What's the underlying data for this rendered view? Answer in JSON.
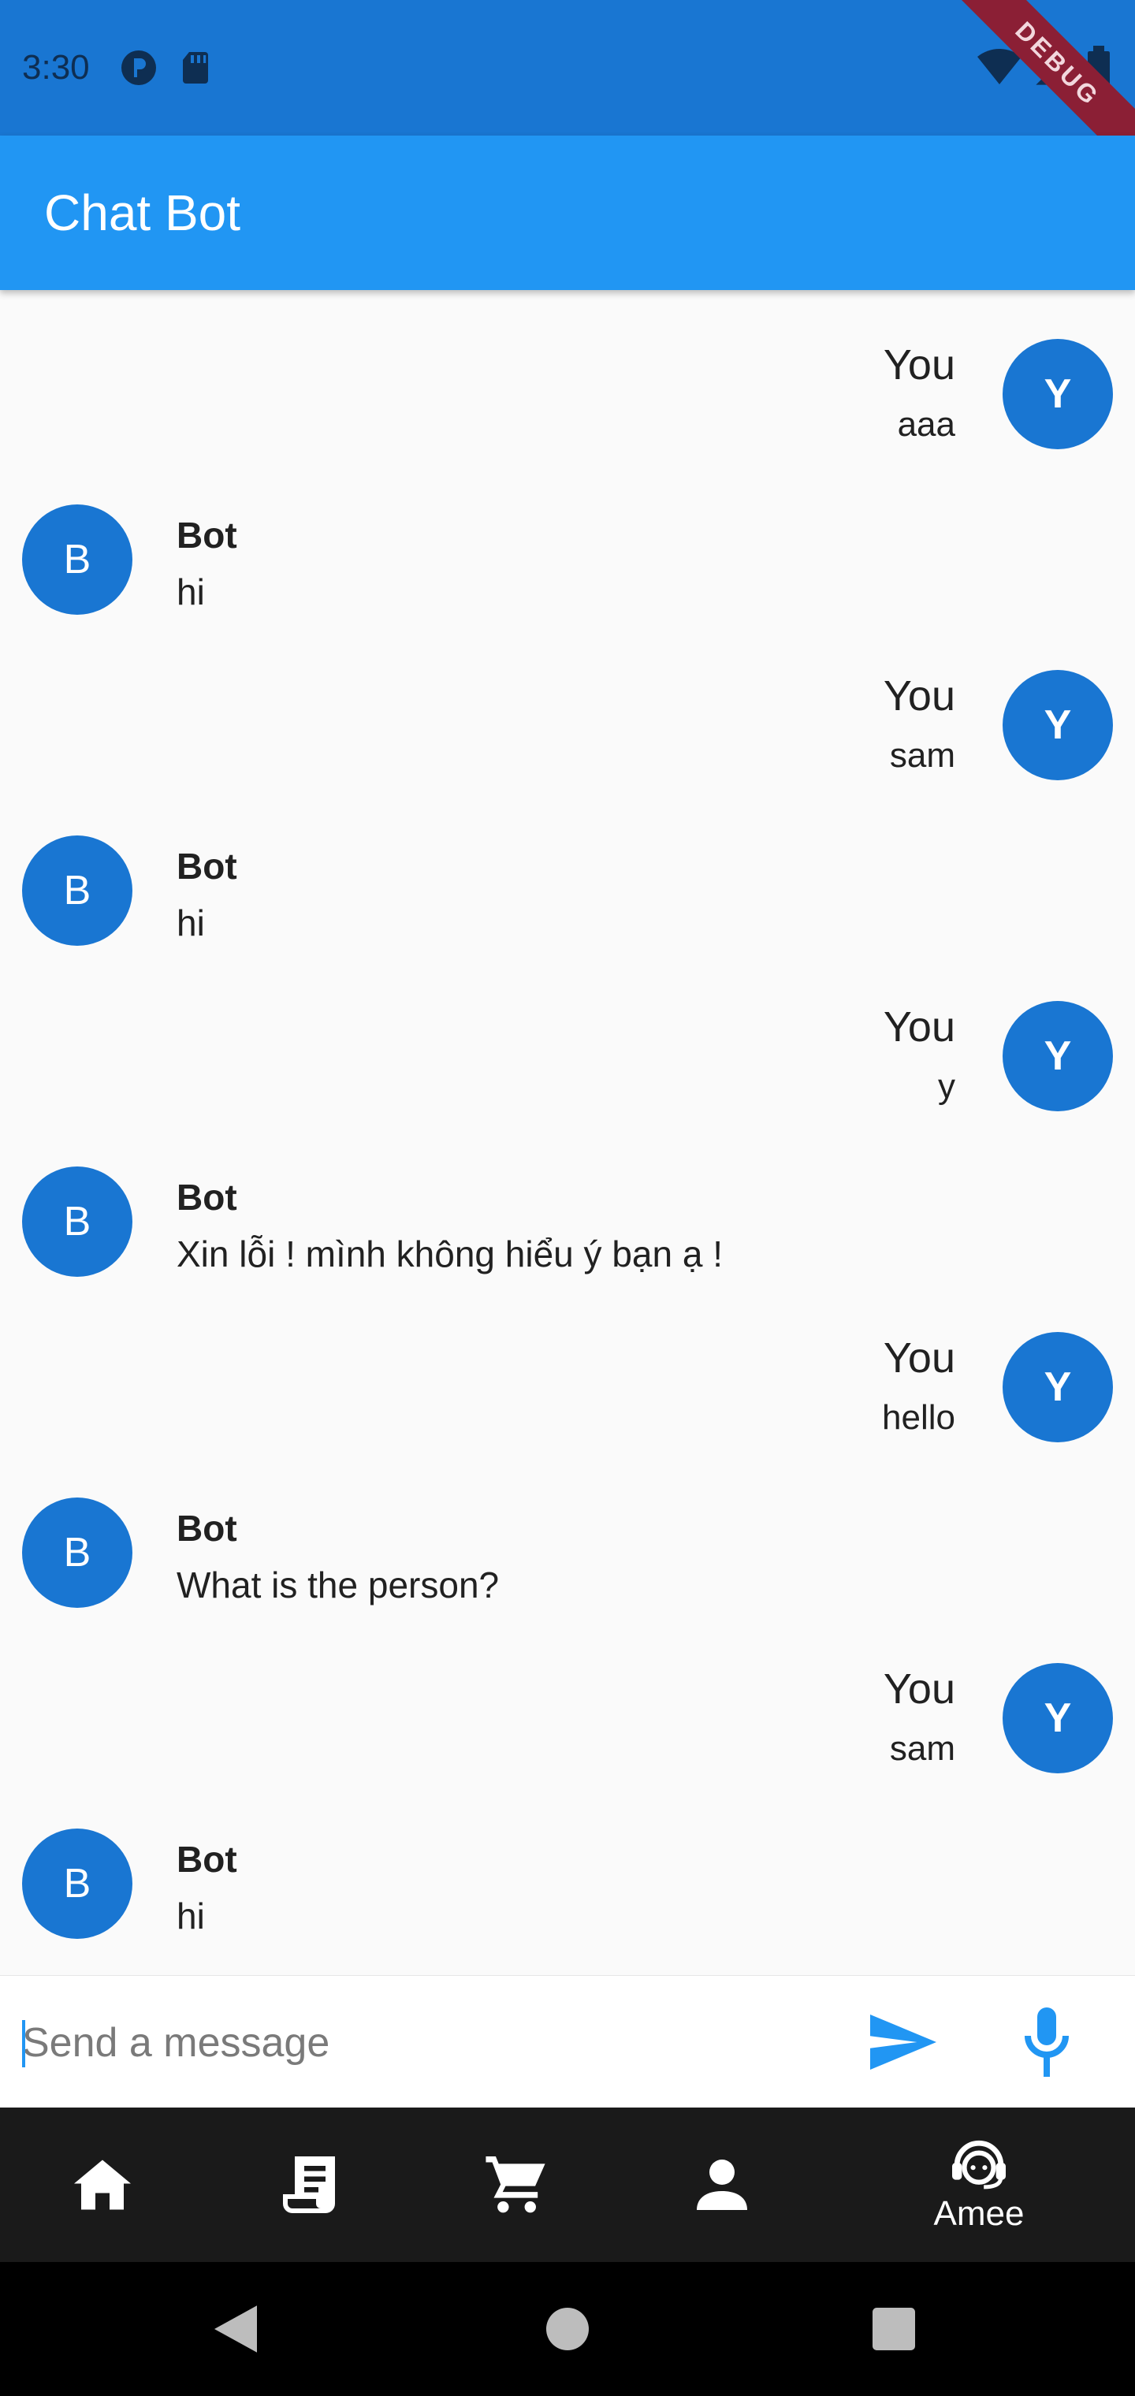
{
  "status_bar": {
    "time": "3:30",
    "icons_left": [
      "p-circle-icon",
      "sd-card-icon"
    ],
    "icons_right": [
      "wifi-icon",
      "signal-icon",
      "battery-icon"
    ],
    "debug_banner": "DEBUG"
  },
  "app_bar": {
    "title": "Chat Bot"
  },
  "messages": [
    {
      "sender": "user",
      "avatar": "Y",
      "name": "You",
      "text": "aaa"
    },
    {
      "sender": "bot",
      "avatar": "B",
      "name": "Bot",
      "text": "hi"
    },
    {
      "sender": "user",
      "avatar": "Y",
      "name": "You",
      "text": "sam"
    },
    {
      "sender": "bot",
      "avatar": "B",
      "name": "Bot",
      "text": "hi"
    },
    {
      "sender": "user",
      "avatar": "Y",
      "name": "You",
      "text": "y"
    },
    {
      "sender": "bot",
      "avatar": "B",
      "name": "Bot",
      "text": "Xin lỗi ! mình không hiểu ý bạn ạ !"
    },
    {
      "sender": "user",
      "avatar": "Y",
      "name": "You",
      "text": "hello"
    },
    {
      "sender": "bot",
      "avatar": "B",
      "name": "Bot",
      "text": "What is the person?"
    },
    {
      "sender": "user",
      "avatar": "Y",
      "name": "You",
      "text": "sam"
    },
    {
      "sender": "bot",
      "avatar": "B",
      "name": "Bot",
      "text": "hi"
    }
  ],
  "input": {
    "placeholder": "Send a message",
    "value": ""
  },
  "bottom_nav": {
    "items": [
      {
        "icon": "home-icon",
        "label": ""
      },
      {
        "icon": "receipt-icon",
        "label": ""
      },
      {
        "icon": "cart-icon",
        "label": ""
      },
      {
        "icon": "person-icon",
        "label": ""
      },
      {
        "icon": "support-agent-icon",
        "label": "Amee"
      }
    ]
  },
  "colors": {
    "status_bar": "#1976d2",
    "app_bar": "#2196f3",
    "avatar": "#1976d2",
    "accent": "#2196f3",
    "bottom_nav": "#1a1a1a"
  }
}
